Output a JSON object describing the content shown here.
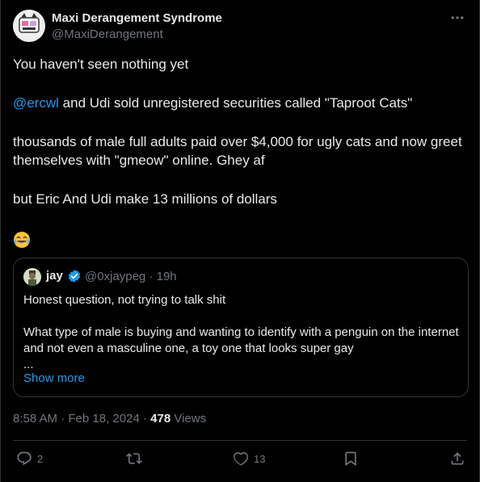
{
  "author": {
    "name": "Maxi Derangement Syndrome",
    "handle": "@MaxiDerangement"
  },
  "tweet": {
    "line1": "You haven't seen nothing yet",
    "mention": "@ercwl",
    "line2_rest": " and Udi sold unregistered securities called \"Taproot Cats\"",
    "line3": "thousands of male full adults paid over $4,000 for ugly cats and now greet themselves with \"gmeow\" online. Ghey af",
    "line4": "but Eric And Udi make 13 millions of dollars",
    "emoji": "😂"
  },
  "quote": {
    "name": "jay",
    "handle": "@0xjaypeg",
    "time": "19h",
    "line1": "Honest question, not trying to talk shit",
    "line2": "What type of male is buying and wanting to identify with a penguin on the internet and not even a masculine one, a toy one that looks super gay",
    "ellipsis": "...",
    "show_more": "Show more"
  },
  "meta": {
    "time": "8:58 AM",
    "date": "Feb 18, 2024",
    "views_count": "478",
    "views_label": "Views"
  },
  "actions": {
    "replies": "2",
    "reposts": "",
    "likes": "13"
  },
  "colors": {
    "background": "#000000",
    "text": "#e7e9ea",
    "secondary": "#71767b",
    "link": "#1d9bf0",
    "border": "#2f3336"
  }
}
